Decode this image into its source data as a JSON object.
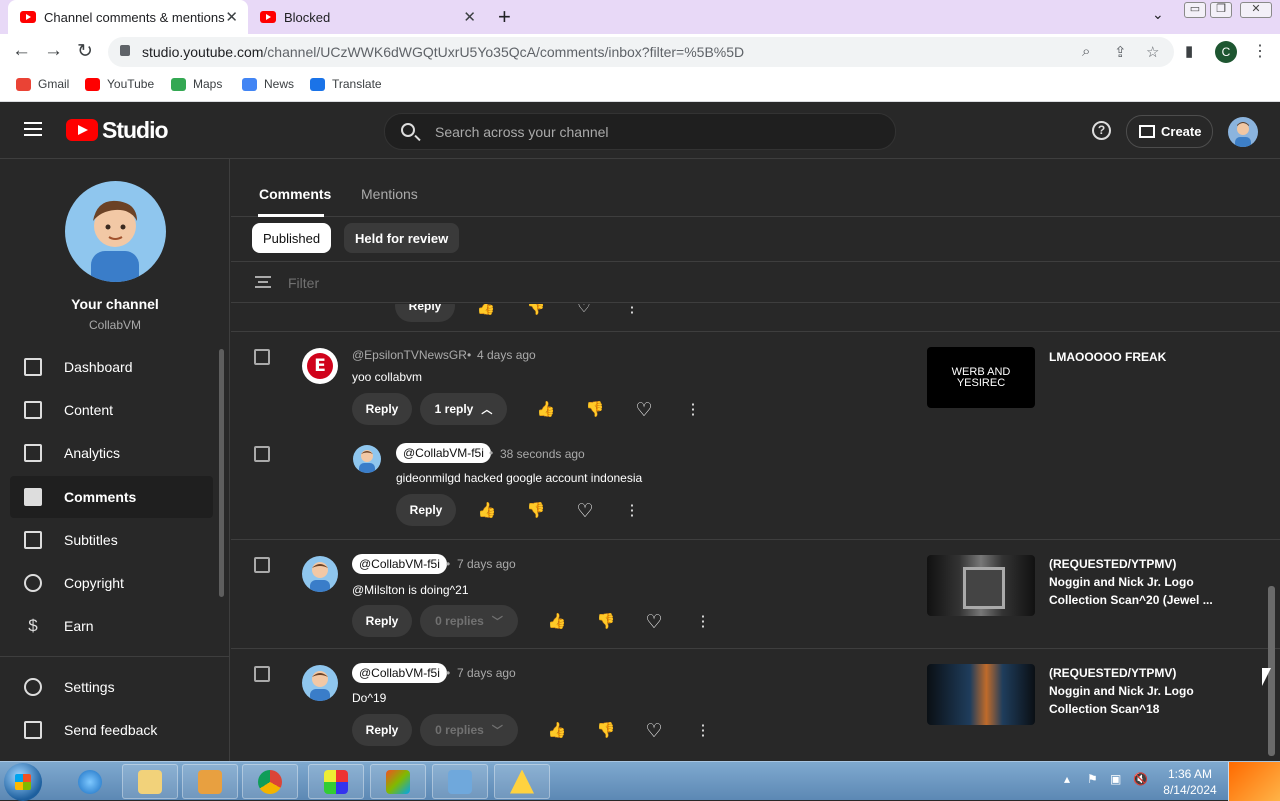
{
  "browser": {
    "tabs": [
      {
        "title": "Channel comments & mentions",
        "active": true
      },
      {
        "title": "Blocked",
        "active": false
      }
    ],
    "url_host": "studio.youtube.com",
    "url_path": "/channel/UCzWWK6dWGQtUxrU5Yo35QcA/comments/inbox?filter=%5B%5D",
    "profile_letter": "C",
    "bookmarks": [
      "Gmail",
      "YouTube",
      "Maps",
      "News",
      "Translate"
    ]
  },
  "header": {
    "logo": "Studio",
    "search_placeholder": "Search across your channel",
    "help": "?",
    "create_label": "Create"
  },
  "sidebar": {
    "your_channel": "Your channel",
    "channel_name": "CollabVM",
    "items": [
      {
        "label": "Dashboard",
        "icon": "dashboard-icon"
      },
      {
        "label": "Content",
        "icon": "content-icon"
      },
      {
        "label": "Analytics",
        "icon": "analytics-icon"
      },
      {
        "label": "Comments",
        "icon": "comments-icon",
        "active": true
      },
      {
        "label": "Subtitles",
        "icon": "subtitles-icon"
      },
      {
        "label": "Copyright",
        "icon": "copyright-icon"
      },
      {
        "label": "Earn",
        "icon": "earn-icon"
      },
      {
        "label": "Settings",
        "icon": "settings-icon"
      },
      {
        "label": "Send feedback",
        "icon": "feedback-icon"
      }
    ]
  },
  "main": {
    "tabs": [
      "Comments",
      "Mentions"
    ],
    "chips": [
      "Published",
      "Held for review"
    ],
    "filter_placeholder": "Filter",
    "cut_reply": "Reply",
    "comments": [
      {
        "author": "@EpsilonTVNewsGR",
        "ago": "4 days ago",
        "text": "yoo collabvm",
        "reply": "Reply",
        "replies": "1 reply",
        "video_thumb_text": "WERB AND YESIREC",
        "video_title": "LMAOOOOO FREAK",
        "sub": {
          "author": "@CollabVM-f5i",
          "ago": "38 seconds ago",
          "text": "gideonmilgd hacked google account indonesia",
          "reply": "Reply"
        }
      },
      {
        "author": "@CollabVM-f5i",
        "ago": "7 days ago",
        "text": "@Milslton is doing^21",
        "reply": "Reply",
        "replies": "0 replies",
        "video_title": "(REQUESTED/YTPMV) Noggin and Nick Jr. Logo Collection Scan^20 (Jewel ..."
      },
      {
        "author": "@CollabVM-f5i",
        "ago": "7 days ago",
        "text": "Do^19",
        "reply": "Reply",
        "replies": "0 replies",
        "video_title": "(REQUESTED/YTPMV) Noggin and Nick Jr. Logo Collection Scan^18"
      }
    ]
  },
  "taskbar": {
    "time": "1:36 AM",
    "date": "8/14/2024"
  }
}
